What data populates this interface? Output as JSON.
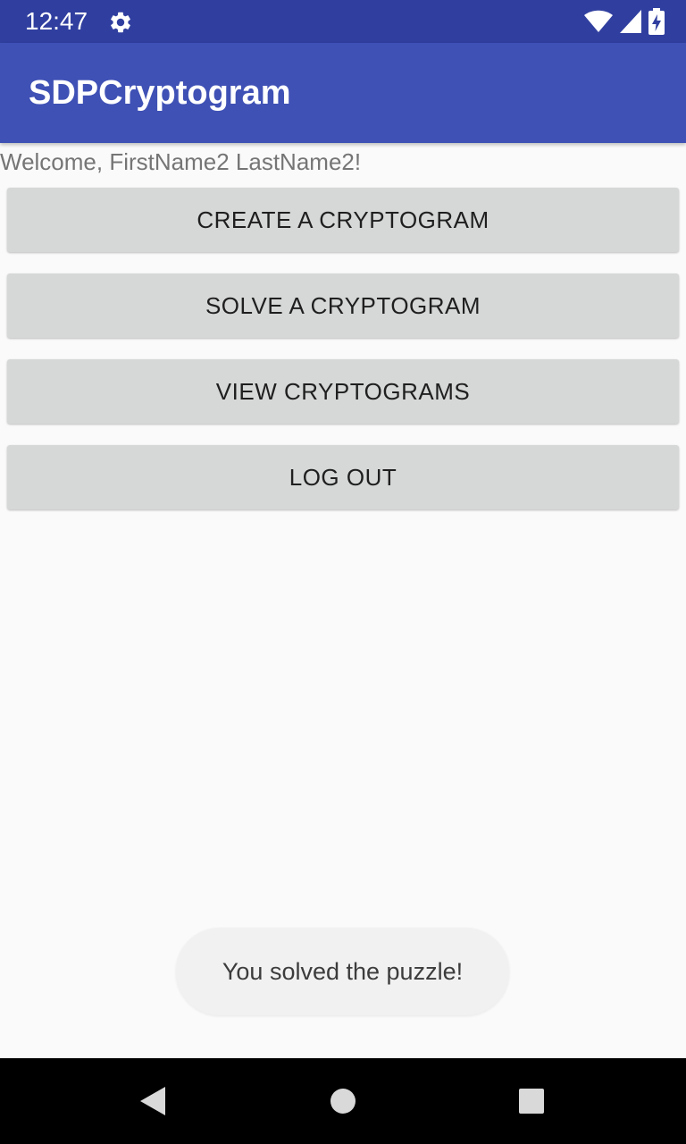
{
  "status_bar": {
    "time": "12:47",
    "icons": [
      "settings-gear-icon",
      "wifi-icon",
      "cell-signal-icon",
      "battery-charging-icon"
    ],
    "background": "#303f9f"
  },
  "app_bar": {
    "title": "SDPCryptogram",
    "background": "#3f51b5"
  },
  "main": {
    "welcome_text": "Welcome, FirstName2 LastName2!",
    "buttons": [
      {
        "label": "CREATE A CRYPTOGRAM"
      },
      {
        "label": "SOLVE A CRYPTOGRAM"
      },
      {
        "label": "VIEW CRYPTOGRAMS"
      },
      {
        "label": "LOG OUT"
      }
    ]
  },
  "toast": {
    "message": "You solved the puzzle!"
  },
  "nav_bar": {
    "icons": [
      "back-icon",
      "home-icon",
      "recents-icon"
    ]
  }
}
